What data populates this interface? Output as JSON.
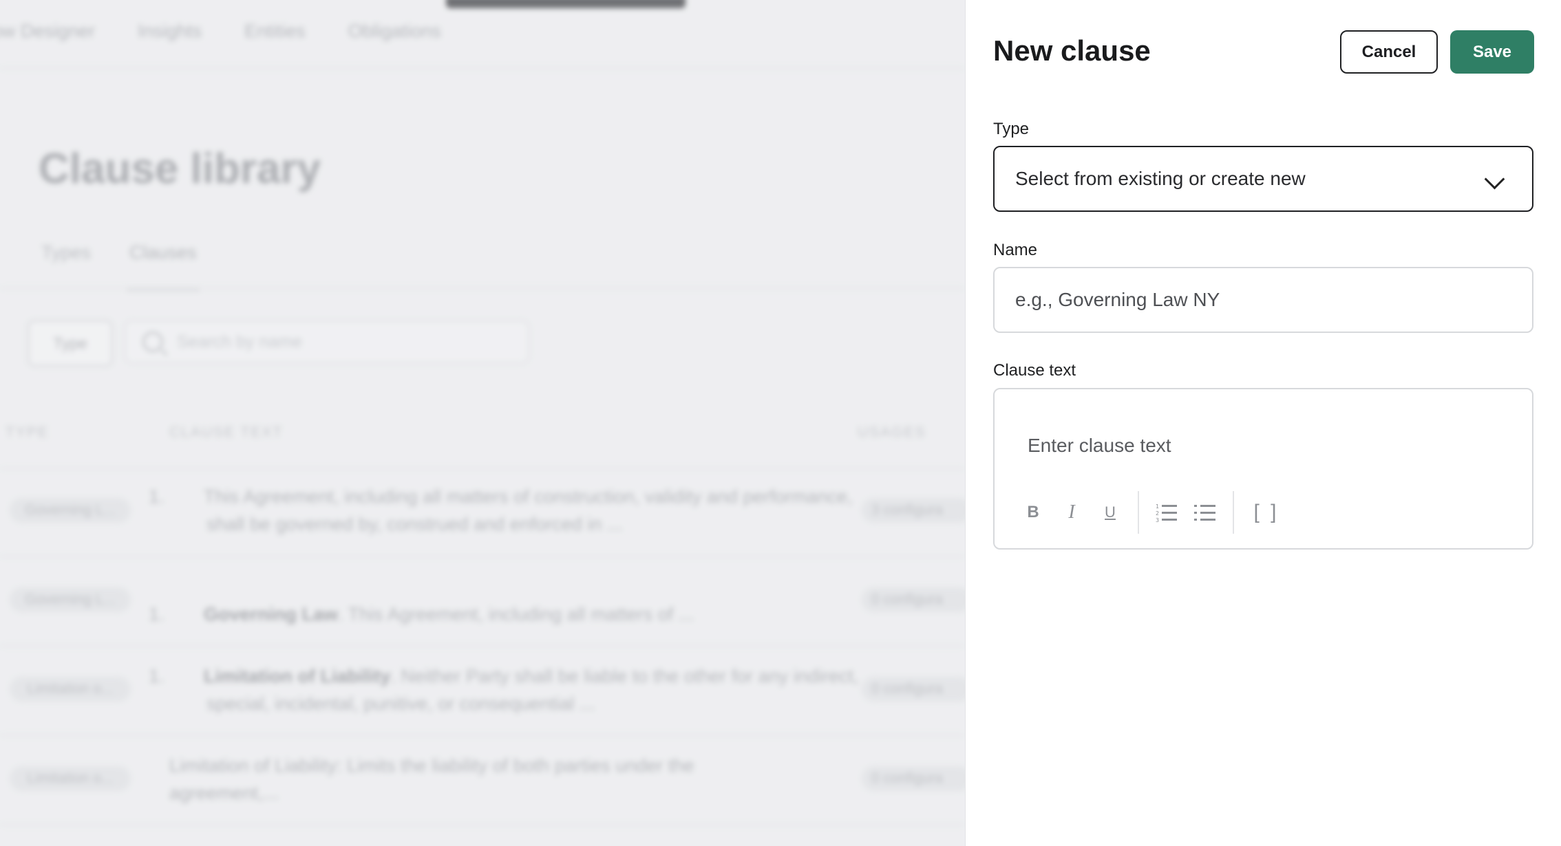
{
  "background": {
    "nav": [
      "ow Designer",
      "Insights",
      "Entities",
      "Obligations"
    ],
    "page_title": "Clause library",
    "tabs": [
      "Types",
      "Clauses"
    ],
    "filter_label": "Type",
    "search_placeholder": "Search by name",
    "columns": [
      "TYPE",
      "CLAUSE TEXT",
      "USAGES"
    ],
    "rows": [
      {
        "type": "Governing L...",
        "num": "1.",
        "bold": "",
        "text": "This Agreement, including all matters of construction, validity and performance, shall be governed by, construed and enforced in ...",
        "usage": "3 configura"
      },
      {
        "type": "Governing L...",
        "num": "1.",
        "bold": "Governing Law",
        "text": ". This Agreement, including all matters of ...",
        "usage": "0 configura"
      },
      {
        "type": "Limitation o...",
        "num": "1.",
        "bold": "Limitation of Liability",
        "text": ". Neither Party shall be liable to the other for any indirect, special, incidental, punitive, or consequential ...",
        "usage": "0 configura"
      },
      {
        "type": "Limitation o...",
        "num": "",
        "bold": "",
        "text": "Limitation of Liability: Limits the liability of both parties under the agreement,...",
        "usage": "0 configura"
      }
    ]
  },
  "panel": {
    "title": "New clause",
    "cancel_label": "Cancel",
    "save_label": "Save",
    "type_label": "Type",
    "type_value": "Select from existing or create new",
    "name_label": "Name",
    "name_placeholder": "e.g., Governing Law NY",
    "clause_text_label": "Clause text",
    "clause_text_placeholder": "Enter clause text",
    "toolbar": {
      "bold": "B",
      "italic": "I",
      "underline": "U",
      "brackets": "[ ]"
    },
    "accent_color": "#2f7f65"
  }
}
